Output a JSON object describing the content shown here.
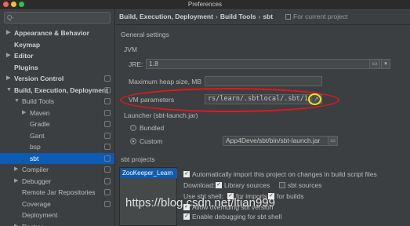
{
  "window": {
    "title": "Preferences"
  },
  "sidebar": {
    "search_placeholder": "Q-",
    "items": [
      {
        "label": "Appearance & Behavior",
        "bold": true,
        "arrow": "▶"
      },
      {
        "label": "Keymap",
        "bold": true,
        "arrow": ""
      },
      {
        "label": "Editor",
        "bold": true,
        "arrow": "▶"
      },
      {
        "label": "Plugins",
        "bold": true,
        "arrow": ""
      },
      {
        "label": "Version Control",
        "bold": true,
        "arrow": "▶"
      },
      {
        "label": "Build, Execution, Deployment",
        "bold": true,
        "arrow": "▼"
      },
      {
        "label": "Build Tools",
        "bold": false,
        "arrow": "▼"
      },
      {
        "label": "Maven",
        "bold": false,
        "arrow": "▶"
      },
      {
        "label": "Gradle",
        "bold": false,
        "arrow": ""
      },
      {
        "label": "Gant",
        "bold": false,
        "arrow": ""
      },
      {
        "label": "bsp",
        "bold": false,
        "arrow": ""
      },
      {
        "label": "sbt",
        "bold": false,
        "arrow": ""
      },
      {
        "label": "Compiler",
        "bold": false,
        "arrow": "▶"
      },
      {
        "label": "Debugger",
        "bold": false,
        "arrow": "▶"
      },
      {
        "label": "Remote Jar Repositories",
        "bold": false,
        "arrow": ""
      },
      {
        "label": "Coverage",
        "bold": false,
        "arrow": ""
      },
      {
        "label": "Deployment",
        "bold": false,
        "arrow": ""
      },
      {
        "label": "Docker",
        "bold": false,
        "arrow": "▶"
      }
    ],
    "selected": "sbt"
  },
  "main": {
    "breadcrumb": [
      "Build, Execution, Deployment",
      "Build Tools",
      "sbt"
    ],
    "for_current_project": "For current project",
    "general_settings": "General settings",
    "jvm_section": "JVM",
    "jre_label": "JRE:",
    "jre_value": "1.8",
    "heap_label": "Maximum heap size, MB",
    "vm_label": "VM parameters",
    "vm_value": "rs/learn/.sbtlocal/.sbt/1.0",
    "launcher_section": "Launcher (sbt-launch.jar)",
    "bundled_label": "Bundled",
    "custom_label": "Custom",
    "custom_path": "App4Deve/sbt/bin/sbt-launch.jar",
    "sbt_projects_section": "sbt projects",
    "project_name": "ZooKeeper_Learn",
    "auto_import_label": "Automatically import this project on changes in build script files",
    "download_label": "Download:",
    "library_sources_label": "Library sources",
    "sbt_sources_label": "sbt sources",
    "use_sbt_shell_label": "Use sbt shell:",
    "for_imports_label": "for imports",
    "for_builds_label": "for builds",
    "allow_override_label": "Allow overriding sbt version",
    "enable_debug_label": "Enable debugging for sbt shell"
  },
  "watermark": "https://blog.csdn.net/ltian999",
  "colors": {
    "selection": "#0d5bb3",
    "annotation_red": "#e8151b",
    "annotation_yellow": "#f1e60a"
  }
}
